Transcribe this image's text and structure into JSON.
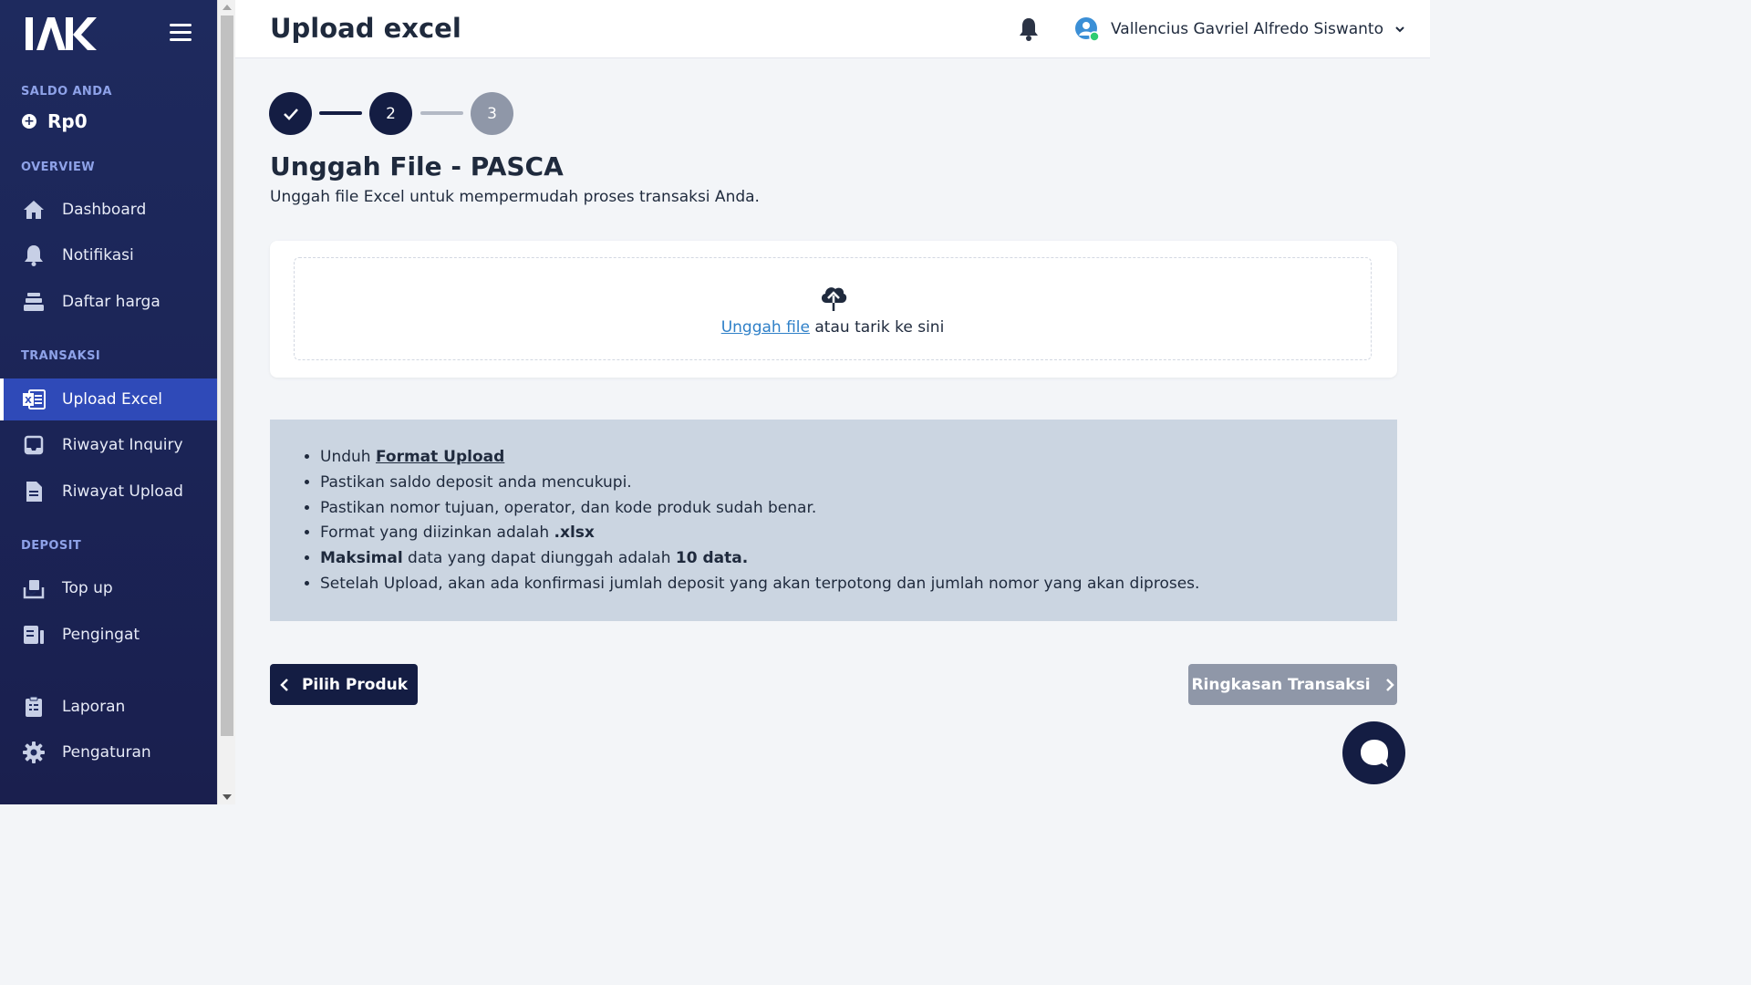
{
  "sidebar": {
    "logo_text": "IAK",
    "balance_label": "SALDO ANDA",
    "balance_value": "Rp0",
    "sections": {
      "overview": "OVERVIEW",
      "transaksi": "TRANSAKSI",
      "deposit": "DEPOSIT"
    },
    "items": {
      "dashboard": "Dashboard",
      "notifikasi": "Notifikasi",
      "daftar_harga": "Daftar harga",
      "upload_excel": "Upload Excel",
      "riwayat_inquiry": "Riwayat Inquiry",
      "riwayat_upload": "Riwayat Upload",
      "top_up": "Top up",
      "pengingat": "Pengingat",
      "laporan": "Laporan",
      "pengaturan": "Pengaturan"
    },
    "active_item": "upload_excel"
  },
  "header": {
    "title": "Upload excel",
    "user_name": "Vallencius Gavriel Alfredo Siswanto"
  },
  "stepper": {
    "steps": [
      "✓",
      "2",
      "3"
    ],
    "current": 2
  },
  "main": {
    "title": "Unggah File - PASCA",
    "subtitle": "Unggah file Excel untuk mempermudah proses transaksi Anda.",
    "upload": {
      "link_text": "Unggah file",
      "rest_text": " atau tarik ke sini"
    },
    "info": {
      "item1_prefix": "Unduh ",
      "item1_link": "Format Upload",
      "item2": "Pastikan saldo deposit anda mencukupi.",
      "item3": "Pastikan nomor tujuan, operator, dan kode produk sudah benar.",
      "item4_prefix": "Format yang diizinkan adalah ",
      "item4_bold": ".xlsx",
      "item5_bold1": "Maksimal",
      "item5_mid": " data yang dapat diunggah adalah ",
      "item5_bold2": "10 data.",
      "item6": "Setelah Upload, akan ada konfirmasi jumlah deposit yang akan terpotong dan jumlah nomor yang akan diproses."
    },
    "buttons": {
      "back": "Pilih Produk",
      "next": "Ringkasan Transaksi"
    }
  },
  "colors": {
    "sidebar_bg": "#1e2a5e",
    "active_item": "#2f4ab8",
    "primary_dark": "#141d43",
    "disabled": "#8f97a8",
    "info_bg": "#cbd5e1",
    "link": "#2f80c8"
  }
}
